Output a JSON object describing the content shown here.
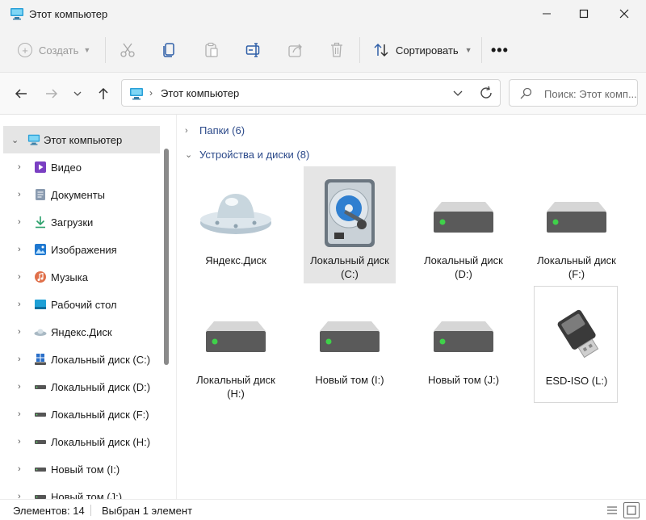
{
  "window": {
    "title": "Этот компьютер"
  },
  "toolbar": {
    "create_label": "Создать",
    "sort_label": "Сортировать",
    "more_label": "•••"
  },
  "address": {
    "crumb": "Этот компьютер",
    "search_placeholder": "Поиск: Этот комп..."
  },
  "sidebar": {
    "items": [
      {
        "label": "Этот компьютер",
        "icon": "computer-icon"
      },
      {
        "label": "Видео",
        "icon": "video-icon"
      },
      {
        "label": "Документы",
        "icon": "documents-icon"
      },
      {
        "label": "Загрузки",
        "icon": "downloads-icon"
      },
      {
        "label": "Изображения",
        "icon": "pictures-icon"
      },
      {
        "label": "Музыка",
        "icon": "music-icon"
      },
      {
        "label": "Рабочий стол",
        "icon": "desktop-icon"
      },
      {
        "label": "Яндекс.Диск",
        "icon": "ufo-icon"
      },
      {
        "label": "Локальный диск (C:)",
        "icon": "drive-icon"
      },
      {
        "label": "Локальный диск (D:)",
        "icon": "drive-icon"
      },
      {
        "label": "Локальный диск (F:)",
        "icon": "drive-icon"
      },
      {
        "label": "Локальный диск (H:)",
        "icon": "drive-icon"
      },
      {
        "label": "Новый том (I:)",
        "icon": "drive-icon"
      },
      {
        "label": "Новый том (J:)",
        "icon": "drive-icon"
      }
    ]
  },
  "main": {
    "folders_group": "Папки (6)",
    "devices_group": "Устройства и диски (8)",
    "tiles": [
      {
        "line1": "Яндекс.Диск",
        "line2": "",
        "icon": "ufo-icon"
      },
      {
        "line1": "Локальный диск",
        "line2": "(C:)",
        "icon": "hard-disk-icon"
      },
      {
        "line1": "Локальный диск",
        "line2": "(D:)",
        "icon": "drive-icon"
      },
      {
        "line1": "Локальный диск",
        "line2": "(F:)",
        "icon": "drive-icon"
      },
      {
        "line1": "Локальный диск",
        "line2": "(H:)",
        "icon": "drive-icon"
      },
      {
        "line1": "Новый том (I:)",
        "line2": "",
        "icon": "drive-icon"
      },
      {
        "line1": "Новый том (J:)",
        "line2": "",
        "icon": "drive-icon"
      },
      {
        "line1": "ESD-ISO (L:)",
        "line2": "",
        "icon": "usb-drive-icon"
      }
    ]
  },
  "status": {
    "count": "Элементов: 14",
    "selected": "Выбран 1 элемент"
  },
  "colors": {
    "accent": "#2c4a8a",
    "drive_led": "#3fd14a",
    "selected_bg": "#e5e5e5"
  }
}
